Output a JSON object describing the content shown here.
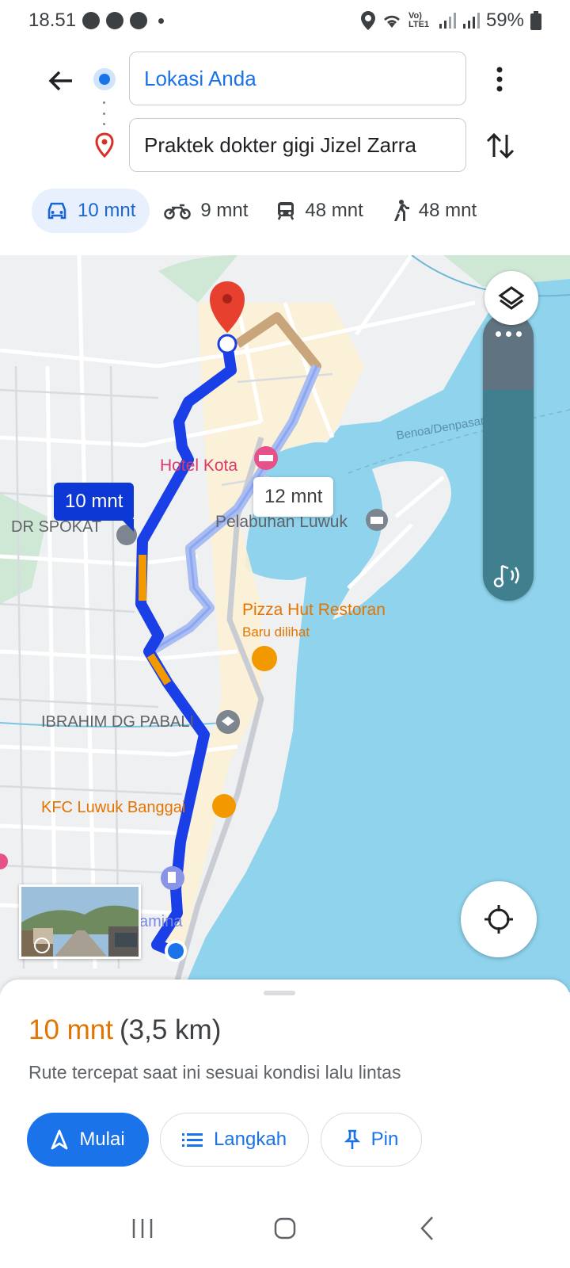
{
  "status": {
    "time": "18.51",
    "network_label": "Vo) LTE1",
    "battery": "59%"
  },
  "directions": {
    "origin": "Lokasi Anda",
    "destination": "Praktek dokter gigi Jizel Zarra"
  },
  "modes": [
    {
      "name": "car",
      "label": "10 mnt",
      "active": true
    },
    {
      "name": "motorcycle",
      "label": "9 mnt",
      "active": false
    },
    {
      "name": "transit",
      "label": "48 mnt",
      "active": false
    },
    {
      "name": "walk",
      "label": "48 mnt",
      "active": false
    }
  ],
  "map": {
    "labels": {
      "hotel": "Hotel Kota",
      "spokat": "DR SPOKAT",
      "pelabuhan": "Pelabuhan Luwuk",
      "pizza": "Pizza Hut Restoran",
      "pizza_sub": "Baru dilihat",
      "ibrahim": "IBRAHIM DG PABALI",
      "kfc": "KFC Luwuk Banggai",
      "pertamina": "amina",
      "benoa": "Benoa/Denpasar"
    },
    "callout_main": "10 mnt",
    "callout_alt": "12 mnt"
  },
  "sheet": {
    "duration": "10 mnt",
    "distance": "(3,5 km)",
    "subtitle": "Rute tercepat saat ini sesuai kondisi lalu lintas",
    "start_label": "Mulai",
    "steps_label": "Langkah",
    "pin_label": "Pin"
  },
  "colors": {
    "accent": "#1a73e8",
    "route_main": "#1a3fe6",
    "route_alt": "#a9bdf5",
    "traffic": "#f29900",
    "water": "#8fd3ec",
    "duration_text": "#e37400"
  }
}
